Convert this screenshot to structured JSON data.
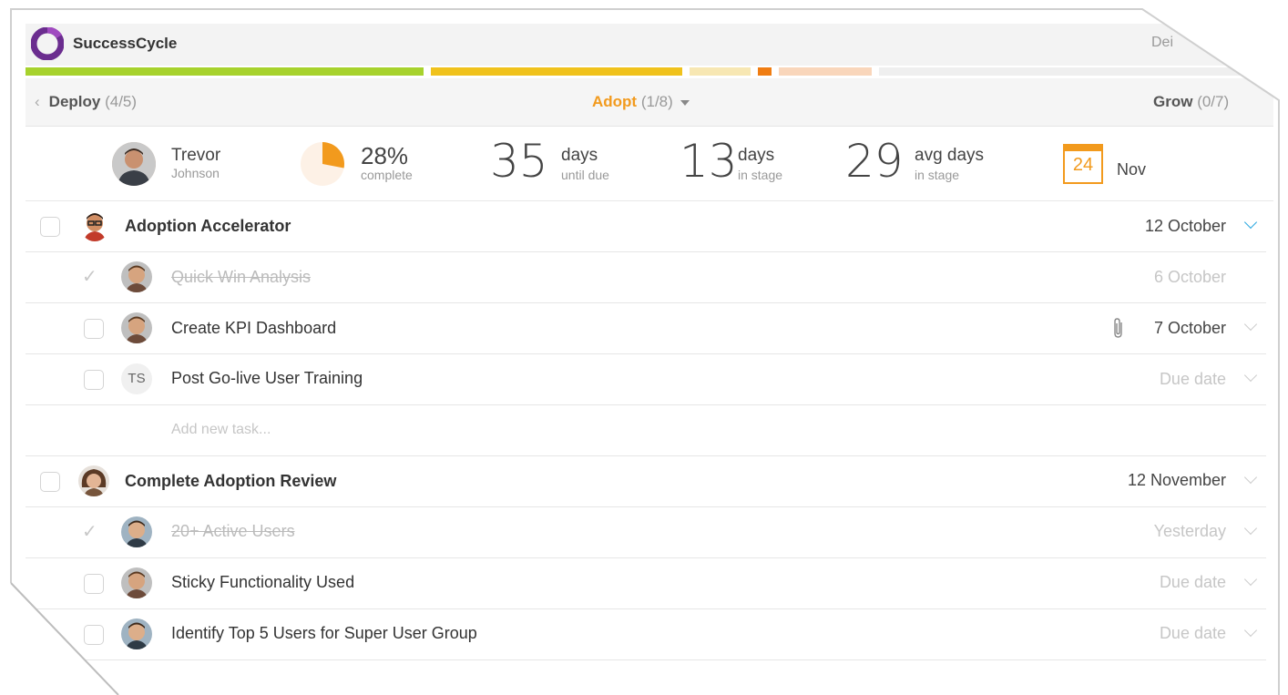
{
  "app": {
    "title": "SuccessCycle",
    "top_right": "Dei"
  },
  "colors": {
    "green": "#a7d22d",
    "yellow": "#f0c21c",
    "orange": "#f29a1d",
    "blue": "#2aa7e0"
  },
  "progress": {
    "segments": [
      {
        "color": "#a7d22d",
        "fraction": 0.325
      },
      {
        "color": "#f0c21c",
        "fraction": 0.207
      },
      {
        "color": "#f7e7b3",
        "fraction": 0.055
      },
      {
        "color": "#f07d12",
        "fraction": 0.017
      },
      {
        "color": "#f9d6bb",
        "fraction": 0.08
      },
      {
        "color": "#efefef",
        "fraction": 0.306
      }
    ]
  },
  "stages": {
    "prev": {
      "name": "Deploy",
      "count": "(4/5)"
    },
    "current": {
      "name": "Adopt",
      "count": "(1/8)"
    },
    "next": {
      "name": "Grow",
      "count": "(0/7)"
    }
  },
  "stats": {
    "owner": {
      "first": "Trevor",
      "last": "Johnson"
    },
    "complete": {
      "value": "28%",
      "label": "complete",
      "fraction": 0.28
    },
    "due": {
      "value": "35",
      "unit": "days",
      "label": "until due"
    },
    "in_stage": {
      "value": "13",
      "unit": "days",
      "label": "in stage"
    },
    "avg": {
      "value": "29",
      "unit": "avg days",
      "label": "in stage"
    },
    "calendar": {
      "day": "24",
      "month": "Nov"
    }
  },
  "groups": [
    {
      "title": "Adoption Accelerator",
      "date": "12 October",
      "tasks": [
        {
          "title": "Quick Win Analysis",
          "date": "6 October",
          "done": true
        },
        {
          "title": "Create KPI Dashboard",
          "date": "7 October",
          "done": false
        },
        {
          "title": "Post Go-live User Training",
          "date": "Due date",
          "done": false,
          "initials": "TS"
        }
      ],
      "add_task": "Add new task..."
    },
    {
      "title": "Complete Adoption Review",
      "date": "12 November",
      "tasks": [
        {
          "title": "20+ Active Users",
          "date": "Yesterday",
          "done": true
        },
        {
          "title": "Sticky Functionality Used",
          "date": "Due date",
          "done": false
        },
        {
          "title": "Identify Top 5 Users for Super User Group",
          "date": "Due date",
          "done": false
        }
      ]
    }
  ]
}
